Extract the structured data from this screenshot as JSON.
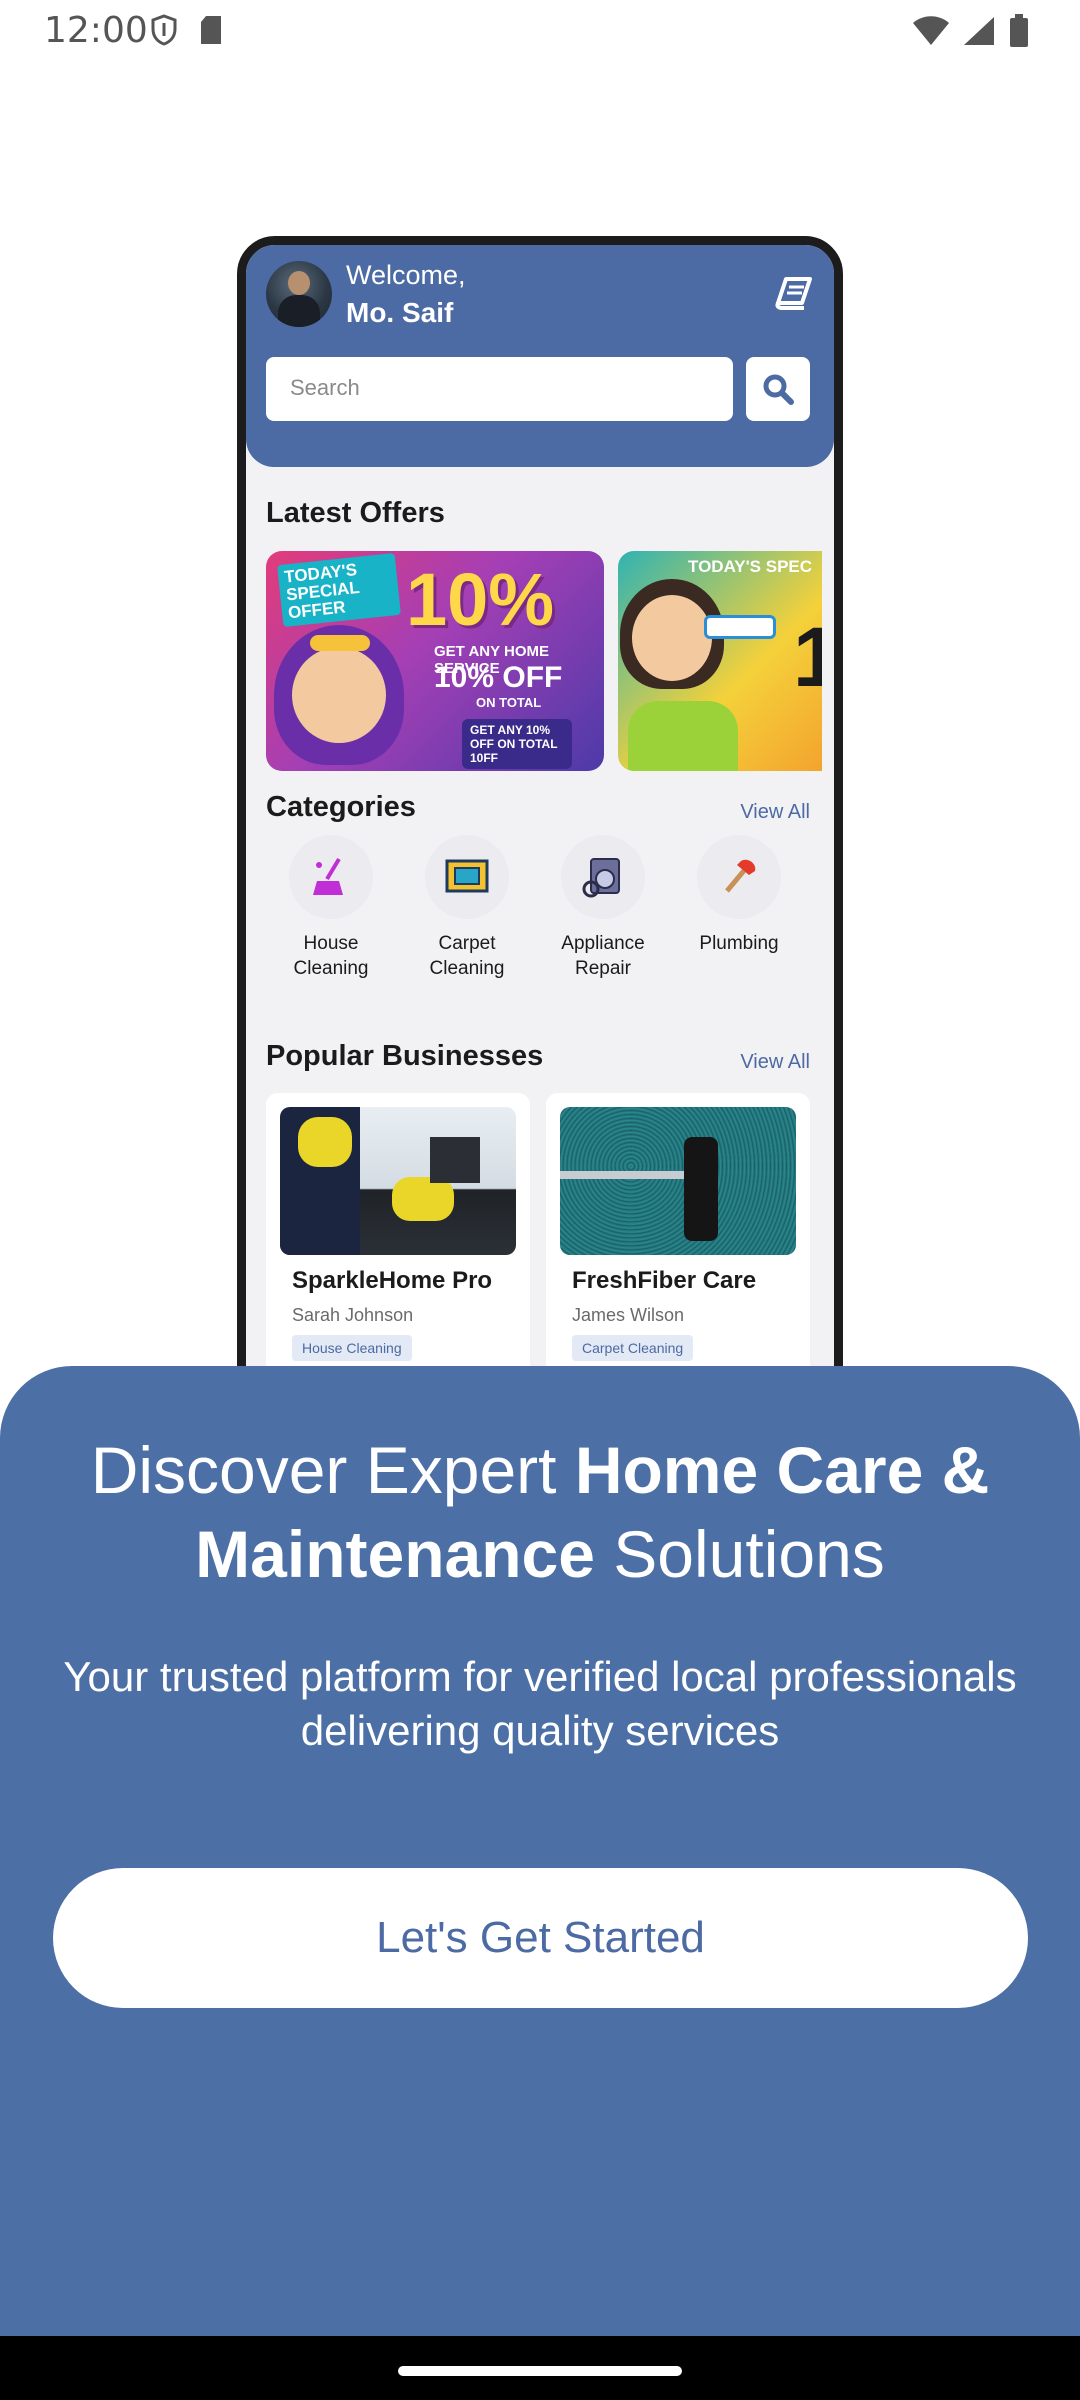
{
  "status_bar": {
    "time": "12:00",
    "icons": [
      "shield-icon",
      "sd-card-icon",
      "wifi-icon",
      "signal-icon",
      "battery-icon"
    ]
  },
  "mockup": {
    "header": {
      "welcome": "Welcome,",
      "user_name": "Mo. Saif",
      "search_placeholder": "Search",
      "accent_color": "#4c6aa3"
    },
    "latest_offers": {
      "title": "Latest Offers",
      "offer1": {
        "badge": "TODAY'S SPECIAL OFFER",
        "percent": "10%",
        "line1": "GET ANY HOME SERVICE",
        "line2": "10% OFF",
        "line3": "ON TOTAL",
        "line4": "GET ANY 10% OFF ON TOTAL 10FF"
      },
      "offer2": {
        "badge": "TODAY'S SPEC",
        "percent": "1"
      }
    },
    "categories": {
      "title": "Categories",
      "view_all": "View All",
      "items": [
        {
          "label": "House Cleaning"
        },
        {
          "label": "Carpet Cleaning"
        },
        {
          "label": "Appliance Repair"
        },
        {
          "label": "Plumbing"
        }
      ]
    },
    "popular": {
      "title": "Popular Businesses",
      "view_all": "View All",
      "items": [
        {
          "name": "SparkleHome Pro",
          "owner": "Sarah Johnson",
          "tag": "House Cleaning"
        },
        {
          "name": "FreshFiber Care",
          "owner": "James Wilson",
          "tag": "Carpet Cleaning"
        }
      ]
    }
  },
  "onboarding": {
    "title_regular_1": "Discover Expert ",
    "title_bold_1": "Home Care &",
    "title_bold_2": "Maintenance",
    "title_regular_2": " Solutions",
    "subtitle": "Your trusted platform for verified local professionals delivering quality services",
    "cta_label": "Let's Get Started",
    "sheet_color": "#4c6fa6"
  }
}
